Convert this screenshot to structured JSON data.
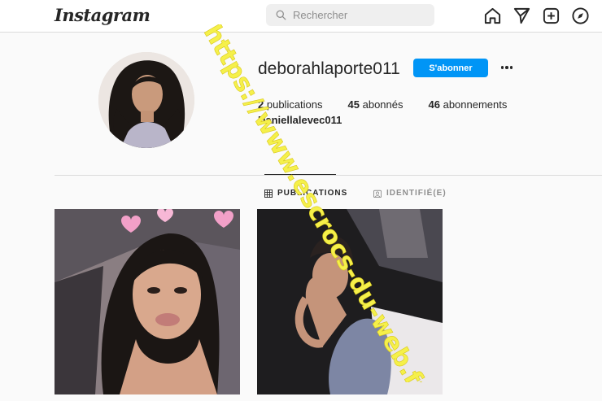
{
  "header": {
    "logo": "Instagram",
    "search_placeholder": "Rechercher",
    "icons": [
      "home-icon",
      "send-icon",
      "new-post-icon",
      "explore-icon"
    ]
  },
  "profile": {
    "username": "deborahlaporte011",
    "follow_label": "S'abonner",
    "stats": {
      "posts_count": "2",
      "posts_label": "publications",
      "followers_count": "45",
      "followers_label": "abonnés",
      "following_count": "46",
      "following_label": "abonnements"
    },
    "full_name": "Daniellalevec011"
  },
  "tabs": [
    {
      "label": "PUBLICATIONS",
      "active": true
    },
    {
      "label": "IDENTIFIÉ(E)",
      "active": false
    }
  ],
  "watermark": "https://www.escrocs-du-web.fr",
  "colors": {
    "accent": "#0095f6",
    "watermark": "#f5f04a"
  }
}
